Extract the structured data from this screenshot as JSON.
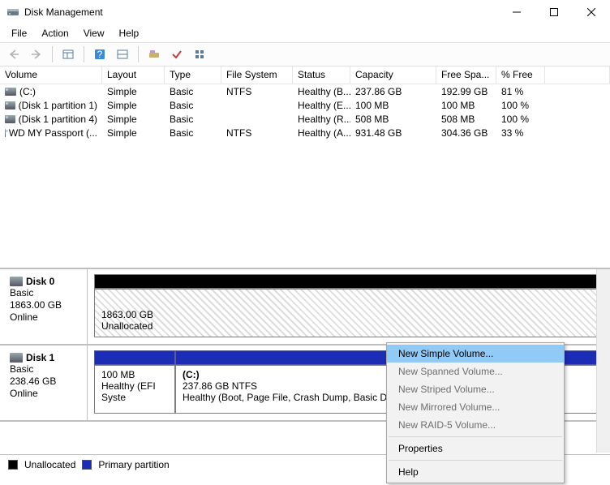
{
  "window": {
    "title": "Disk Management",
    "menu": [
      "File",
      "Action",
      "View",
      "Help"
    ]
  },
  "columns": [
    "Volume",
    "Layout",
    "Type",
    "File System",
    "Status",
    "Capacity",
    "Free Spa...",
    "% Free"
  ],
  "volumes": [
    {
      "name": "(C:)",
      "layout": "Simple",
      "type": "Basic",
      "fs": "NTFS",
      "status": "Healthy (B...",
      "capacity": "237.86 GB",
      "free": "192.99 GB",
      "pct": "81 %"
    },
    {
      "name": "(Disk 1 partition 1)",
      "layout": "Simple",
      "type": "Basic",
      "fs": "",
      "status": "Healthy (E...",
      "capacity": "100 MB",
      "free": "100 MB",
      "pct": "100 %"
    },
    {
      "name": "(Disk 1 partition 4)",
      "layout": "Simple",
      "type": "Basic",
      "fs": "",
      "status": "Healthy (R...",
      "capacity": "508 MB",
      "free": "508 MB",
      "pct": "100 %"
    },
    {
      "name": "WD MY Passport (...",
      "layout": "Simple",
      "type": "Basic",
      "fs": "NTFS",
      "status": "Healthy (A...",
      "capacity": "931.48 GB",
      "free": "304.36 GB",
      "pct": "33 %"
    }
  ],
  "disks": [
    {
      "name": "Disk 0",
      "type": "Basic",
      "size": "1863.00 GB",
      "status": "Online",
      "unallocated": {
        "size": "1863.00 GB",
        "label": "Unallocated"
      }
    },
    {
      "name": "Disk 1",
      "type": "Basic",
      "size": "238.46 GB",
      "status": "Online",
      "partitions": [
        {
          "title": "",
          "line1": "100 MB",
          "line2": "Healthy (EFI Syste"
        },
        {
          "title": "(C:)",
          "line1": "237.86 GB NTFS",
          "line2": "Healthy (Boot, Page File, Crash Dump, Basic D"
        }
      ]
    }
  ],
  "legend": {
    "unallocated": "Unallocated",
    "primary": "Primary partition"
  },
  "context": {
    "items": [
      {
        "label": "New Simple Volume...",
        "enabled": true,
        "highlight": true
      },
      {
        "label": "New Spanned Volume...",
        "enabled": false
      },
      {
        "label": "New Striped Volume...",
        "enabled": false
      },
      {
        "label": "New Mirrored Volume...",
        "enabled": false
      },
      {
        "label": "New RAID-5 Volume...",
        "enabled": false
      },
      {
        "sep": true
      },
      {
        "label": "Properties",
        "enabled": true
      },
      {
        "sep": true
      },
      {
        "label": "Help",
        "enabled": true
      }
    ]
  }
}
